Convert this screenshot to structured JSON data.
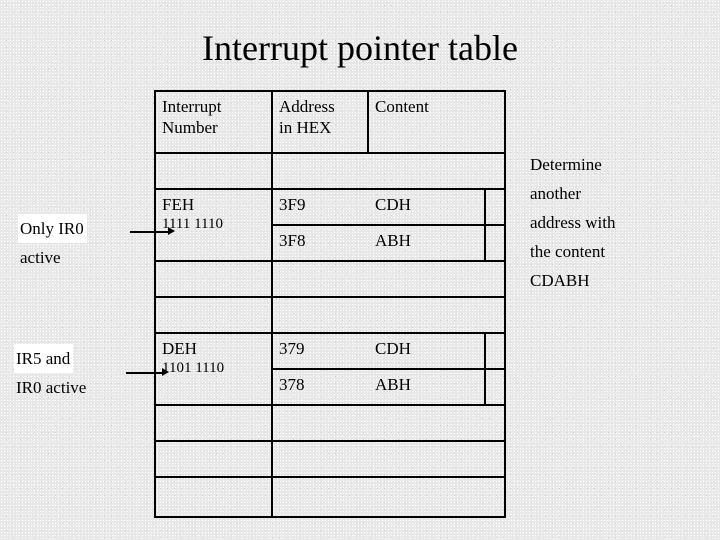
{
  "slide": {
    "title": "Interrupt pointer table",
    "background_color": "#e9e9e9",
    "text_color": "#000000"
  },
  "table": {
    "columns": [
      "Interrupt Number",
      "Address in HEX",
      "Content"
    ],
    "header": {
      "col1_line1": "Interrupt",
      "col1_line2": "Number",
      "col2_line1": "Address",
      "col2_line2": "in HEX",
      "col3_line1": "Content"
    },
    "rows": [
      {
        "type": "empty"
      },
      {
        "type": "data",
        "interrupt_hex": "FEH",
        "interrupt_binary": "1111 1110",
        "entries": [
          {
            "address": "3F9",
            "content": "CDH"
          },
          {
            "address": "3F8",
            "content": "ABH"
          }
        ]
      },
      {
        "type": "empty"
      },
      {
        "type": "empty"
      },
      {
        "type": "data",
        "interrupt_hex": "DEH",
        "interrupt_binary": "1101 1110",
        "entries": [
          {
            "address": "379",
            "content": "CDH"
          },
          {
            "address": "378",
            "content": "ABH"
          }
        ]
      },
      {
        "type": "empty"
      },
      {
        "type": "empty"
      },
      {
        "type": "empty"
      }
    ]
  },
  "callouts": [
    {
      "line1": "Only IR0",
      "line2": "active",
      "highlight_line1": true
    },
    {
      "line1": "IR5 and",
      "line2": "IR0 active",
      "highlight_line1": true
    }
  ],
  "right_note": {
    "line1": "Determine",
    "line2": "another",
    "line3": "address with",
    "line4": "the content",
    "line5": "CDABH"
  }
}
